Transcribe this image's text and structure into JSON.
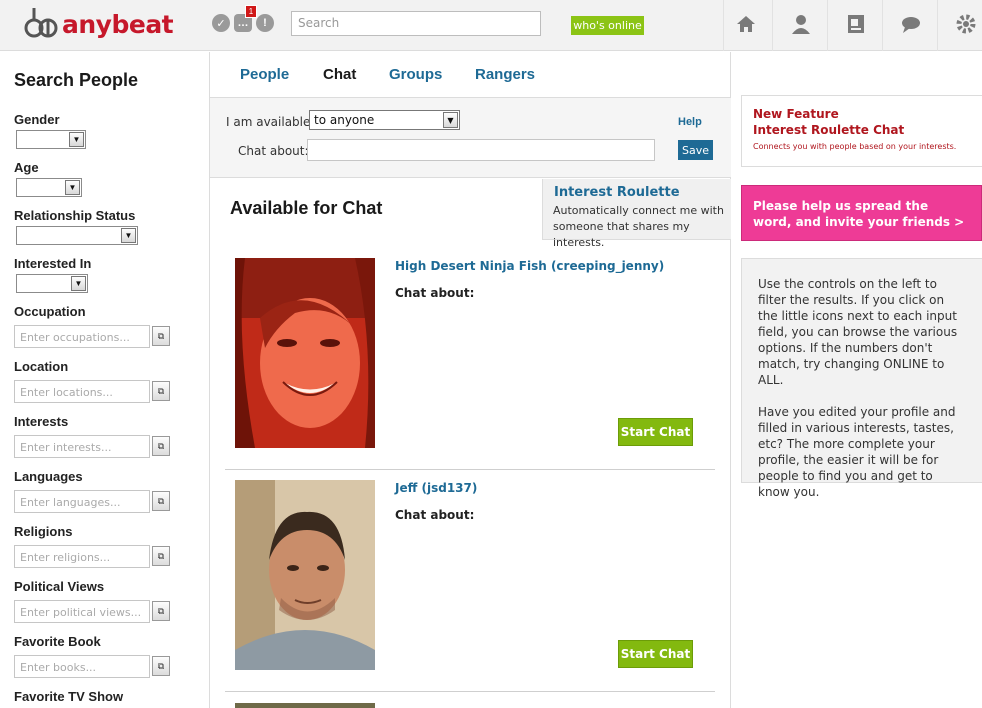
{
  "header": {
    "logo_text": "anybeat",
    "notification_count": "1",
    "search_placeholder": "Search",
    "whos_online_label": "who's online"
  },
  "sidebar": {
    "title": "Search People",
    "fields": [
      {
        "label": "Gender",
        "type": "select-small"
      },
      {
        "label": "Age",
        "type": "select-small"
      },
      {
        "label": "Relationship Status",
        "type": "select-wide"
      },
      {
        "label": "Interested In",
        "type": "select-small"
      },
      {
        "label": "Occupation",
        "placeholder": "Enter occupations..."
      },
      {
        "label": "Location",
        "placeholder": "Enter locations..."
      },
      {
        "label": "Interests",
        "placeholder": "Enter interests..."
      },
      {
        "label": "Languages",
        "placeholder": "Enter languages..."
      },
      {
        "label": "Religions",
        "placeholder": "Enter religions..."
      },
      {
        "label": "Political Views",
        "placeholder": "Enter political views..."
      },
      {
        "label": "Favorite Book",
        "placeholder": "Enter books..."
      },
      {
        "label": "Favorite TV Show"
      }
    ]
  },
  "tabs": [
    "People",
    "Chat",
    "Groups",
    "Rangers"
  ],
  "active_tab": "Chat",
  "availability": {
    "label": "I am available:",
    "value": "to anyone",
    "chat_about_label": "Chat about:",
    "help_label": "Help",
    "save_label": "Save"
  },
  "main": {
    "section_title": "Available for Chat",
    "roulette_title": "Interest Roulette",
    "roulette_desc": "Automatically connect me with someone that shares my interests."
  },
  "people": [
    {
      "name": "High Desert Ninja Fish (creeping_jenny)",
      "chat_about": "Chat about:",
      "button": "Start Chat"
    },
    {
      "name": "Jeff (jsd137)",
      "chat_about": "Chat about:",
      "button": "Start Chat"
    }
  ],
  "right": {
    "feature_title": "New Feature",
    "feature_sub": "Interest Roulette Chat",
    "feature_desc": "Connects you with people based on your interests.",
    "spread_word": "Please help us spread the word, and invite your friends >",
    "info_p1": "Use the controls on the left to filter the results. If you click on the little icons next to each input field, you can browse the various options. If the numbers don't match, try changing ONLINE to ALL.",
    "info_p2": "Have you edited your profile and filled in various interests, tastes, etc? The more complete your profile, the easier it will be for people to find you and get to know you."
  },
  "colors": {
    "brand_red": "#c6182b",
    "link_blue": "#1e6a95",
    "green": "#83b90f",
    "pink": "#ee3b96"
  }
}
